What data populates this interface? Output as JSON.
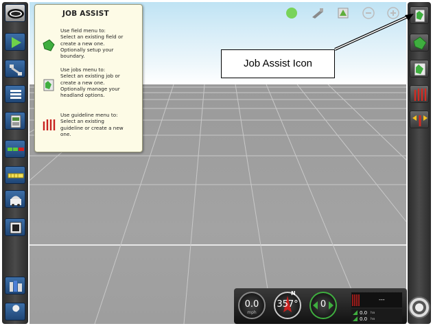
{
  "left_toolbar": {
    "buttons": [
      {
        "name": "brand-logo-icon"
      },
      {
        "name": "run-screen-icon"
      },
      {
        "name": "vehicle-setup-icon"
      },
      {
        "name": "list-settings-icon"
      },
      {
        "name": "console-icon"
      },
      {
        "name": "boom-sections-icon"
      },
      {
        "name": "implement-icon"
      },
      {
        "name": "guidance-icon"
      },
      {
        "name": "display-icon"
      },
      {
        "name": "job-report-icon"
      },
      {
        "name": "wrench-icon"
      }
    ]
  },
  "job_assist": {
    "title": "JOB ASSIST",
    "items": [
      {
        "icon": "field-menu-icon",
        "text": "Use field menu to:\nSelect an existing field or\ncreate a new one.\nOptionally setup your\nboundary."
      },
      {
        "icon": "jobs-menu-icon",
        "text": "Use jobs menu to:\nSelect an existing job or\ncreate a new one.\nOptionally manage your\nheadland options."
      },
      {
        "icon": "guideline-menu-icon",
        "text": "Use guideline menu to:\nSelect an existing\nguideline or create a new\none."
      }
    ]
  },
  "top_icons": [
    "gps-status-icon",
    "view-mode-icon",
    "field-view-icon",
    "zoom-out-icon",
    "zoom-in-icon"
  ],
  "right_toolbar": {
    "buttons": [
      "job-assist-icon",
      "field-icon",
      "job-icon",
      "guideline-icon",
      "nudge-icon"
    ]
  },
  "callout": {
    "text": "Job Assist Icon"
  },
  "status_bar": {
    "speed": "0.0",
    "speed_unit": "mph",
    "heading": "357°",
    "heading_label": "N",
    "steering": "0",
    "cross_track": "---",
    "area_1": "0.0",
    "area_1_unit": "ha",
    "area_2": "0.0",
    "area_2_unit": "ha"
  },
  "colors": {
    "sky_top": "#bfe3f4",
    "ground": "#9a9a9a",
    "popup_bg": "#fdfbe6",
    "accent_green": "#3fae3f",
    "accent_red": "#c8201e"
  }
}
